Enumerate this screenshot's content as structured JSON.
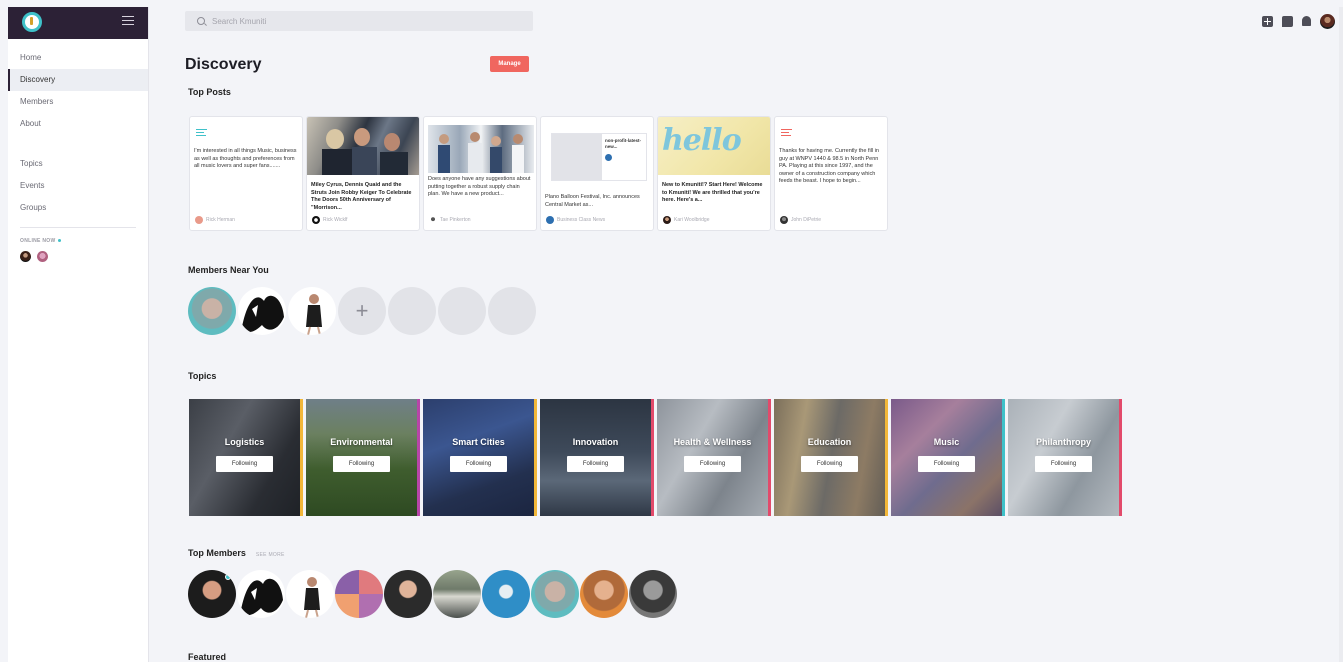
{
  "search": {
    "placeholder": "Search Kmuniti"
  },
  "sidebar": {
    "primary": [
      {
        "label": "Home",
        "active": false
      },
      {
        "label": "Discovery",
        "active": true
      },
      {
        "label": "Members",
        "active": false
      },
      {
        "label": "About",
        "active": false
      }
    ],
    "secondary": [
      {
        "label": "Topics"
      },
      {
        "label": "Events"
      },
      {
        "label": "Groups"
      }
    ],
    "online_label": "ONLINE NOW"
  },
  "header": {
    "icons": [
      "add-icon",
      "chat-icon",
      "bell-icon",
      "profile-avatar"
    ]
  },
  "page": {
    "title": "Discovery",
    "manage_label": "Manage"
  },
  "sections": {
    "top_posts": "Top Posts",
    "members_near": "Members Near You",
    "topics": "Topics",
    "top_members": "Top Members",
    "see_more": "SEE MORE",
    "featured": "Featured"
  },
  "posts": [
    {
      "text": "I'm interested in all things Music, business as well as thoughts and preferences from all music lovers and super fans.......",
      "author": "Rick Herman"
    },
    {
      "text": "Miley Cyrus, Dennis Quaid and the Struts Join Robby Keiger To Celebrate The Doors 50th Anniversary of \"Morrison...",
      "author": "Rick Wicklf"
    },
    {
      "text": "Does anyone have any suggestions about putting together a robust supply chain plan. We have a new product...",
      "author": "Tae Pinkerton"
    },
    {
      "text": "Plano Balloon Festival, Inc. announces Central Market as...",
      "author": "Business Class News",
      "preview_text": "non-profit-latest-new..."
    },
    {
      "text": "New to Kmuniti!? Start Here! Welcome to Kmuniti! We are thrilled that you're here. Here's a...",
      "author": "Kari Woolbridge",
      "image_text": "hello"
    },
    {
      "text": "Thanks for having me. Currently the fill in guy at WNPV 1440 & 98.5 in North Penn PA. Playing at this since 1997, and the owner of a construction company which feeds the beast. I hope to begin...",
      "author": "John DiPetrie"
    }
  ],
  "topics": [
    {
      "name": "Logistics",
      "button": "Following",
      "accent": "#f2b739"
    },
    {
      "name": "Environmental",
      "button": "Following",
      "accent": "#b845a8"
    },
    {
      "name": "Smart Cities",
      "button": "Following",
      "accent": "#f2b739"
    },
    {
      "name": "Innovation",
      "button": "Following",
      "accent": "#e24a6b"
    },
    {
      "name": "Health & Wellness",
      "button": "Following",
      "accent": "#e24a6b"
    },
    {
      "name": "Education",
      "button": "Following",
      "accent": "#f2b739"
    },
    {
      "name": "Music",
      "button": "Following",
      "accent": "#3fc1c9"
    },
    {
      "name": "Philanthropy",
      "button": "Following",
      "accent": "#e24a6b"
    }
  ]
}
